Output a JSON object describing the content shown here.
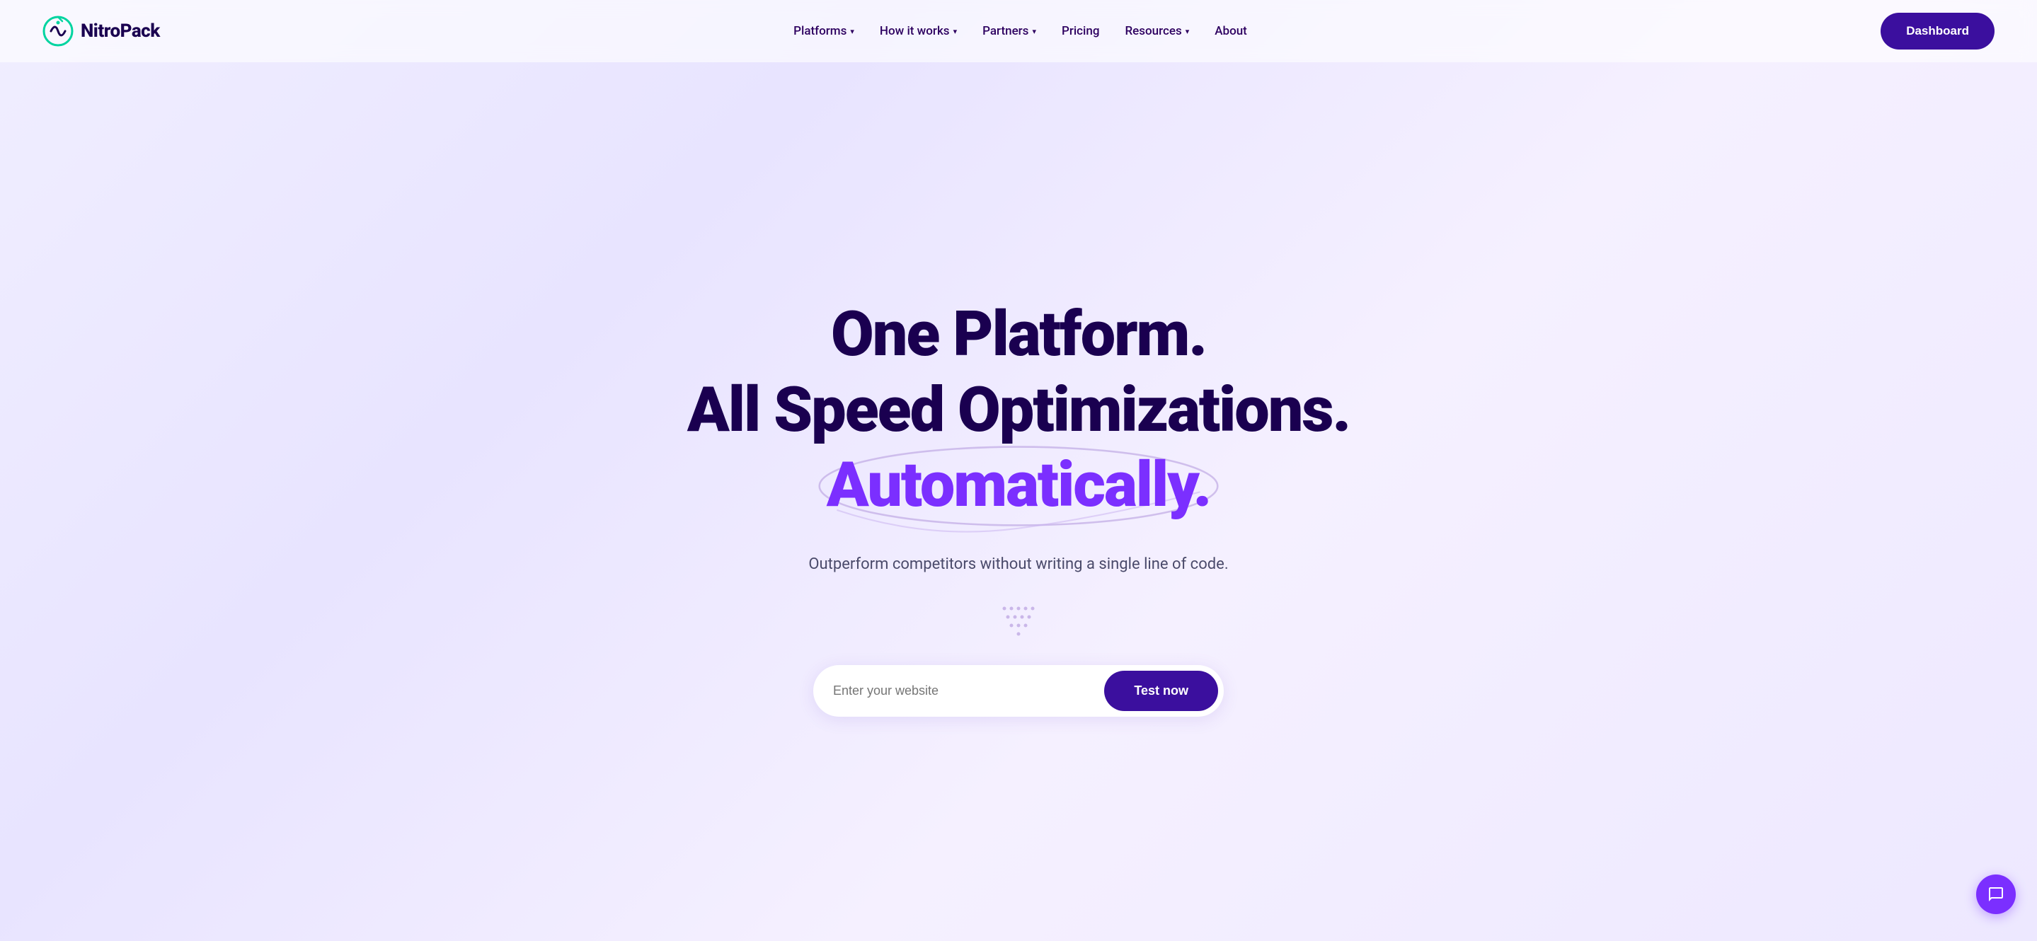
{
  "logo": {
    "text": "NitroPack",
    "aria": "NitroPack logo"
  },
  "navbar": {
    "links": [
      {
        "label": "Platforms",
        "hasDropdown": true
      },
      {
        "label": "How it works",
        "hasDropdown": true
      },
      {
        "label": "Partners",
        "hasDropdown": true
      },
      {
        "label": "Pricing",
        "hasDropdown": false
      },
      {
        "label": "Resources",
        "hasDropdown": true
      },
      {
        "label": "About",
        "hasDropdown": false
      }
    ],
    "dashboard_label": "Dashboard"
  },
  "hero": {
    "line1": "One Platform.",
    "line2": "All Speed Optimizations.",
    "line3": "Automatically.",
    "subtitle": "Outperform competitors without writing a single line of code.",
    "input_placeholder": "Enter your website",
    "cta_label": "Test now"
  },
  "chat": {
    "aria": "Open chat"
  }
}
